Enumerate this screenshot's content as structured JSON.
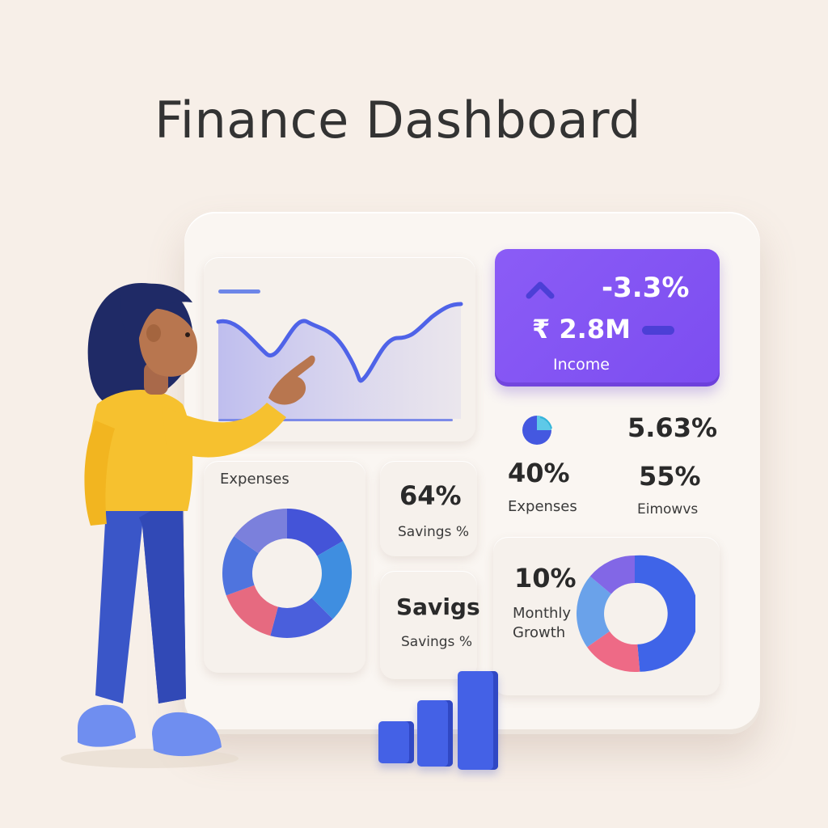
{
  "title": "Finance Dashboard",
  "income": {
    "change": "-3.3%",
    "amount": "₹ 2.8M",
    "label": "Income"
  },
  "expenses_card": {
    "title": "Expenses"
  },
  "savings_card_1": {
    "value": "64%",
    "label": "Savings %"
  },
  "savings_card_2": {
    "value": "Savigs",
    "label": "Savings %"
  },
  "stats": {
    "expenses_value": "40%",
    "expenses_label": "Expenses",
    "pct_value": "5.63%",
    "pct2_value": "55%",
    "pct2_label": "Eimowvs"
  },
  "growth_card": {
    "value": "10%",
    "label_line1": "Monthly",
    "label_line2": "Growth"
  },
  "colors": {
    "accent_purple": "#8b5cf6",
    "blue": "#4461e6",
    "pink": "#ef6b85",
    "background": "#f7efe8"
  }
}
